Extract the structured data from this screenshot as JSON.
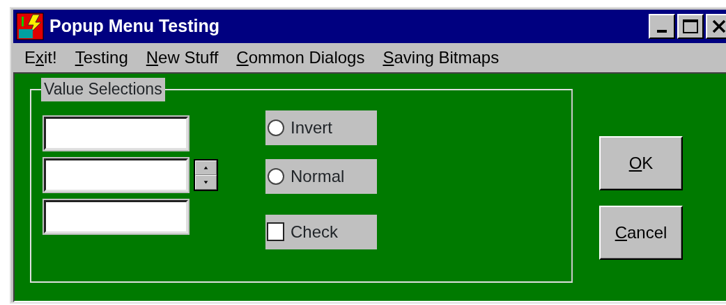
{
  "window": {
    "title": "Popup Menu Testing"
  },
  "menu": [
    {
      "before": "E",
      "key": "x",
      "after": "it!"
    },
    {
      "key": "T",
      "after": "esting"
    },
    {
      "key": "N",
      "after": "ew Stuff"
    },
    {
      "key": "C",
      "after": "ommon Dialogs"
    },
    {
      "key": "S",
      "after": "aving Bitmaps"
    }
  ],
  "group": {
    "title": "Value Selections"
  },
  "fields": [
    {
      "kind": "text"
    },
    {
      "kind": "spin"
    },
    {
      "kind": "text"
    }
  ],
  "options": [
    {
      "kind": "radio",
      "label": "Invert",
      "checked": false
    },
    {
      "kind": "radio",
      "label": "Normal",
      "checked": false
    },
    {
      "kind": "checkbox",
      "label": "Check",
      "checked": false
    }
  ],
  "buttons": [
    {
      "key": "O",
      "after": "K"
    },
    {
      "key": "C",
      "after": "ancel"
    }
  ]
}
